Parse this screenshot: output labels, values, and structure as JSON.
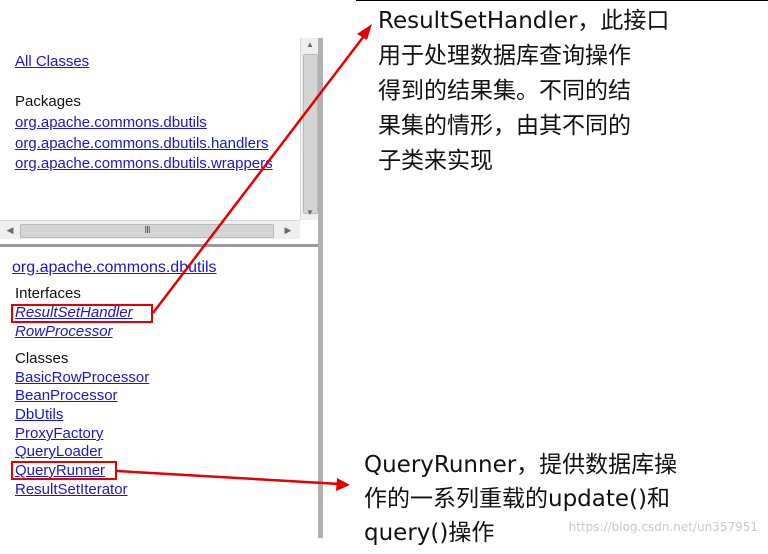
{
  "package_frame": {
    "all_classes_label": "All Classes",
    "packages_heading": "Packages",
    "packages": [
      "org.apache.commons.dbutils",
      "org.apache.commons.dbutils.handlers",
      "org.apache.commons.dbutils.wrappers"
    ],
    "hscroll_grip": "III"
  },
  "class_frame": {
    "package_title": "org.apache.commons.dbutils",
    "interfaces_heading": "Interfaces",
    "interfaces": [
      "ResultSetHandler",
      "RowProcessor"
    ],
    "classes_heading": "Classes",
    "classes": [
      "BasicRowProcessor",
      "BeanProcessor",
      "DbUtils",
      "ProxyFactory",
      "QueryLoader",
      "QueryRunner",
      "ResultSetIterator"
    ]
  },
  "annotations": {
    "result_set_handler_note": [
      "ResultSetHandler，此接口",
      "用于处理数据库查询操作",
      "得到的结果集。不同的结",
      "果集的情形，由其不同的",
      "子类来实现"
    ],
    "query_runner_note": [
      "QueryRunner，提供数据库操",
      "作的一系列重载的update()和",
      "query()操作"
    ],
    "watermark": "https://blog.csdn.net/un357951"
  },
  "colors": {
    "link": "#1b17c7",
    "highlight": "#e30000"
  }
}
